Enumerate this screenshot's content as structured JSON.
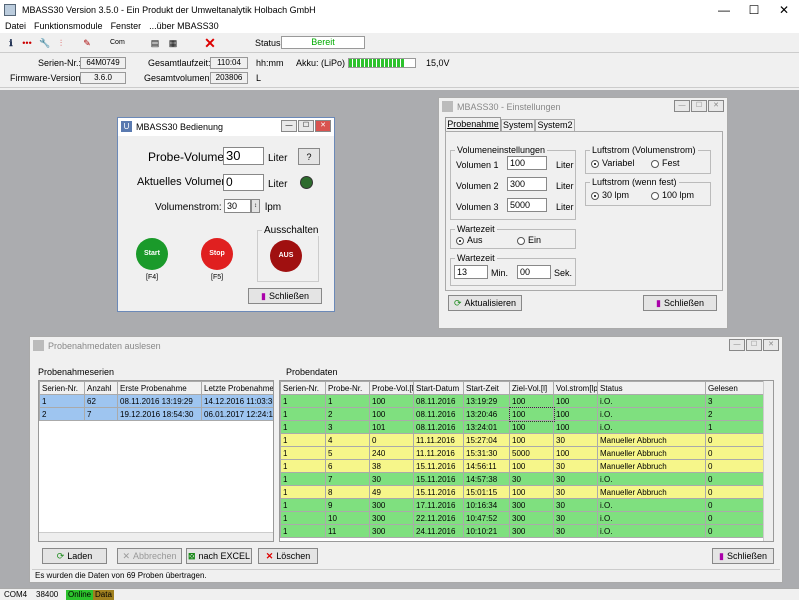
{
  "app": {
    "title": "MBASS30 Version 3.5.0  - Ein Produkt der Umweltanalytik Holbach GmbH",
    "menu": [
      "Datei",
      "Funktionsmodule",
      "Fenster",
      "...über MBASS30"
    ],
    "status_label": "Status:",
    "status_value": "Bereit"
  },
  "info": {
    "serien_label": "Serien-Nr.:",
    "serien_value": "64M0749",
    "firmware_label": "Firmware-Version:",
    "firmware_value": "3.6.0",
    "laufzeit_label": "Gesamtlaufzeit:",
    "laufzeit_value": "110:04",
    "laufzeit_unit": "hh:mm",
    "volumen_label": "Gesamtvolumen:",
    "volumen_value": "203806",
    "volumen_unit": "L",
    "akku_label": "Akku: (LiPo)",
    "akku_value": "15,0V",
    "akku_level": 0.85
  },
  "bedienung": {
    "title": "MBASS30  Bedienung",
    "probe_label": "Probe-Volumen:",
    "probe_value": "30",
    "probe_unit": "Liter",
    "help": "?",
    "akt_label": "Aktuelles Volumen:",
    "akt_value": "0",
    "akt_unit": "Liter",
    "strom_label": "Volumenstrom:",
    "strom_value": "30",
    "strom_unit": "lpm",
    "ausschalten": "Ausschalten",
    "start": "Start",
    "start_key": "[F4]",
    "stop": "Stop",
    "stop_key": "[F5]",
    "aus": "AUS",
    "close": "Schließen"
  },
  "einstellungen": {
    "title": "MBASS30 - Einstellungen",
    "tabs": [
      "Probenahme",
      "System",
      "System2"
    ],
    "vol_group": "Volumeneinstellungen",
    "vol1_label": "Volumen 1",
    "vol1_value": "100",
    "vol2_label": "Volumen 2",
    "vol2_value": "300",
    "vol3_label": "Volumen 3",
    "vol3_value": "5000",
    "liter": "Liter",
    "luft_group": "Luftstrom (Volumenstrom)",
    "variabel": "Variabel",
    "fest": "Fest",
    "luft_fest_group": "Luftstrom (wenn fest)",
    "lpm30": "30 lpm",
    "lpm100": "100 lpm",
    "warte_group": "Wartezeit",
    "aus": "Aus",
    "ein": "Ein",
    "warte_group2": "Wartezeit",
    "min_value": "13",
    "min_label": "Min.",
    "sek_value": "00",
    "sek_label": "Sek.",
    "refresh": "Aktualisieren",
    "close": "Schließen"
  },
  "auslesen": {
    "title": "Probenahmedaten auslesen",
    "serien_title": "Probenahmeserien",
    "serien_headers": [
      "Serien-Nr.",
      "Anzahl",
      "Erste Probenahme",
      "Letzte Probenahme"
    ],
    "serien_rows": [
      [
        "1",
        "62",
        "08.11.2016 13:19:29",
        "14.12.2016 11:03:35"
      ],
      [
        "2",
        "7",
        "19.12.2016 18:54:30",
        "06.01.2017 12:24:17"
      ]
    ],
    "proben_title": "Probendaten",
    "proben_headers": [
      "Serien-Nr.",
      "Probe-Nr.",
      "Probe-Vol.[l]",
      "Start-Datum",
      "Start-Zeit",
      "Ziel-Vol.[l]",
      "Vol.strom[lpm]",
      "Status",
      "Gelesen"
    ],
    "proben_rows": [
      [
        "1",
        "1",
        "100",
        "08.11.2016",
        "13:19:29",
        "100",
        "100",
        "i.O.",
        "3",
        "g"
      ],
      [
        "1",
        "2",
        "100",
        "08.11.2016",
        "13:20:46",
        "100",
        "100",
        "i.O.",
        "2",
        "g"
      ],
      [
        "1",
        "3",
        "101",
        "08.11.2016",
        "13:24:01",
        "100",
        "100",
        "i.O.",
        "1",
        "g"
      ],
      [
        "1",
        "4",
        "0",
        "11.11.2016",
        "15:27:04",
        "100",
        "30",
        "Manueller Abbruch",
        "0",
        "y"
      ],
      [
        "1",
        "5",
        "240",
        "11.11.2016",
        "15:31:30",
        "5000",
        "100",
        "Manueller Abbruch",
        "0",
        "y"
      ],
      [
        "1",
        "6",
        "38",
        "15.11.2016",
        "14:56:11",
        "100",
        "30",
        "Manueller Abbruch",
        "0",
        "y"
      ],
      [
        "1",
        "7",
        "30",
        "15.11.2016",
        "14:57:38",
        "30",
        "30",
        "i.O.",
        "0",
        "g"
      ],
      [
        "1",
        "8",
        "49",
        "15.11.2016",
        "15:01:15",
        "100",
        "30",
        "Manueller Abbruch",
        "0",
        "y"
      ],
      [
        "1",
        "9",
        "300",
        "17.11.2016",
        "10:16:34",
        "300",
        "30",
        "i.O.",
        "0",
        "g"
      ],
      [
        "1",
        "10",
        "300",
        "22.11.2016",
        "10:47:52",
        "300",
        "30",
        "i.O.",
        "0",
        "g"
      ],
      [
        "1",
        "11",
        "300",
        "24.11.2016",
        "10:10:21",
        "300",
        "30",
        "i.O.",
        "0",
        "g"
      ]
    ],
    "laden": "Laden",
    "abbrechen": "Abbrechen",
    "excel": "nach EXCEL",
    "loeschen": "Löschen",
    "close": "Schließen",
    "status": "Es wurden die Daten von 69 Proben übertragen."
  },
  "statusbar": {
    "port": "COM4",
    "baud": "38400",
    "online": "Online",
    "data": "Data"
  },
  "colors": {
    "green_row": "#7fe07f",
    "yellow_row": "#f6f68a",
    "selected_row": "#9ec5f0"
  }
}
